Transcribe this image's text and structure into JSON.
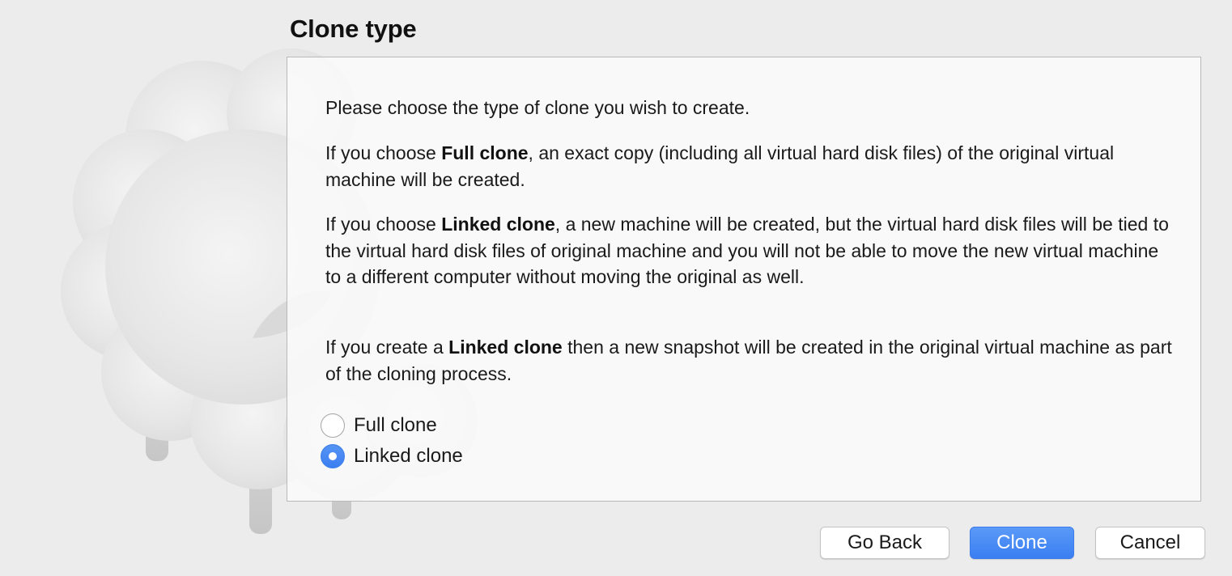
{
  "page": {
    "title": "Clone type"
  },
  "description": {
    "intro": "Please choose the type of clone you wish to create.",
    "full_clone": {
      "pre": "If you choose ",
      "bold": "Full clone",
      "post": ", an exact copy (including all virtual hard disk files) of the original virtual machine will be created."
    },
    "linked_clone": {
      "pre": "If you choose ",
      "bold": "Linked clone",
      "post": ", a new machine will be created, but the virtual hard disk files will be tied to the virtual hard disk files of original machine and you will not be able to move the new virtual machine to a different computer without moving the original as well."
    },
    "snapshot_note": {
      "pre": "If you create a ",
      "bold": "Linked clone",
      "post": " then a new snapshot will be created in the original virtual machine as part of the cloning process."
    }
  },
  "options": [
    {
      "label": "Full clone",
      "selected": false
    },
    {
      "label": "Linked clone",
      "selected": true
    }
  ],
  "buttons": {
    "back": "Go Back",
    "clone": "Clone",
    "cancel": "Cancel"
  },
  "colors": {
    "accent": "#3b7ef0",
    "window_background": "#ececec",
    "panel_background": "#fafafa"
  },
  "icons": {
    "watermark": "sheep-watermark-icon"
  }
}
